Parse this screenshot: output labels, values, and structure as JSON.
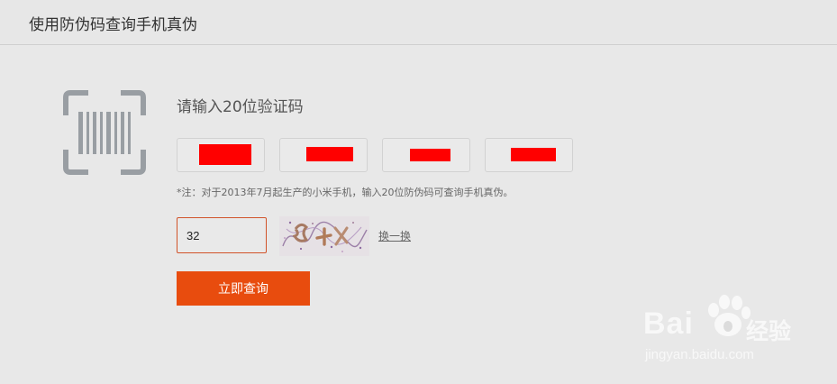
{
  "header": {
    "title": "使用防伪码查询手机真伪"
  },
  "form": {
    "prompt": "请输入20位验证码",
    "note": "*注：对于2013年7月起生产的小米手机，输入20位防伪码可查询手机真伪。",
    "captcha_value": "32",
    "refresh_label": "换一换",
    "submit_label": "立即查询"
  },
  "code_fields": [
    {
      "state": "redacted"
    },
    {
      "state": "redacted"
    },
    {
      "state": "redacted"
    },
    {
      "state": "redacted"
    }
  ],
  "icons": {
    "barcode": "barcode-icon",
    "captcha": "captcha-image"
  },
  "watermark": {
    "brand": "Bai",
    "suffix": "经验",
    "url": "jingyan.baidu.com"
  },
  "colors": {
    "accent": "#e84c0e",
    "input_border": "#d1532a",
    "redaction": "#ff0000"
  }
}
